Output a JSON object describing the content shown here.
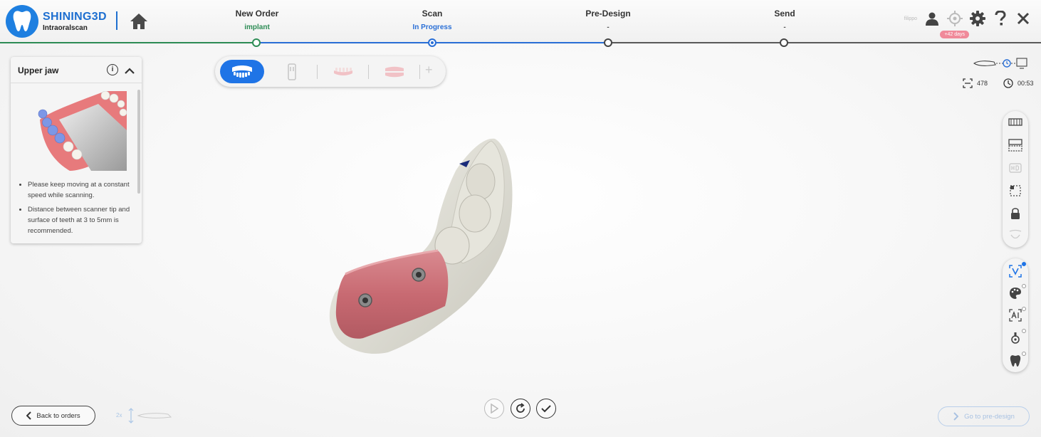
{
  "brand": {
    "name": "SHINING3D",
    "subtitle": "Intraoralscan"
  },
  "steps": [
    {
      "title": "New Order",
      "status": "implant"
    },
    {
      "title": "Scan",
      "status": "In Progress"
    },
    {
      "title": "Pre-Design",
      "status": "-"
    },
    {
      "title": "Send",
      "status": "-"
    }
  ],
  "header": {
    "user_name": "filippo",
    "days_badge": "+42 days",
    "icons": [
      "user-icon",
      "target-icon",
      "gear-icon",
      "help-icon",
      "close-icon"
    ]
  },
  "guide": {
    "title": "Upper jaw",
    "info_label": "i",
    "tips": [
      "Please keep moving at a constant speed while scanning.",
      "Distance between scanner tip and surface of teeth at 3 to 5mm is recommended."
    ]
  },
  "jaw_selector": {
    "add_label": "+"
  },
  "stats": {
    "frames": "478",
    "time": "00:53"
  },
  "toolbar_top": [
    "texture-icon",
    "frames-icon",
    "hd-icon",
    "crop-icon",
    "lock-icon",
    "jaw-icon"
  ],
  "toolbar_bottom": [
    "window-icon",
    "palette-icon",
    "ai-icon",
    "scanbody-icon",
    "tooth-icon"
  ],
  "bottom": {
    "back_label": "Back to orders",
    "next_label": "Go to pre-design",
    "zoom_label": "2x"
  },
  "colors": {
    "accent": "#1f74e6",
    "done": "#2d8c55",
    "badge": "#f08a9a"
  }
}
